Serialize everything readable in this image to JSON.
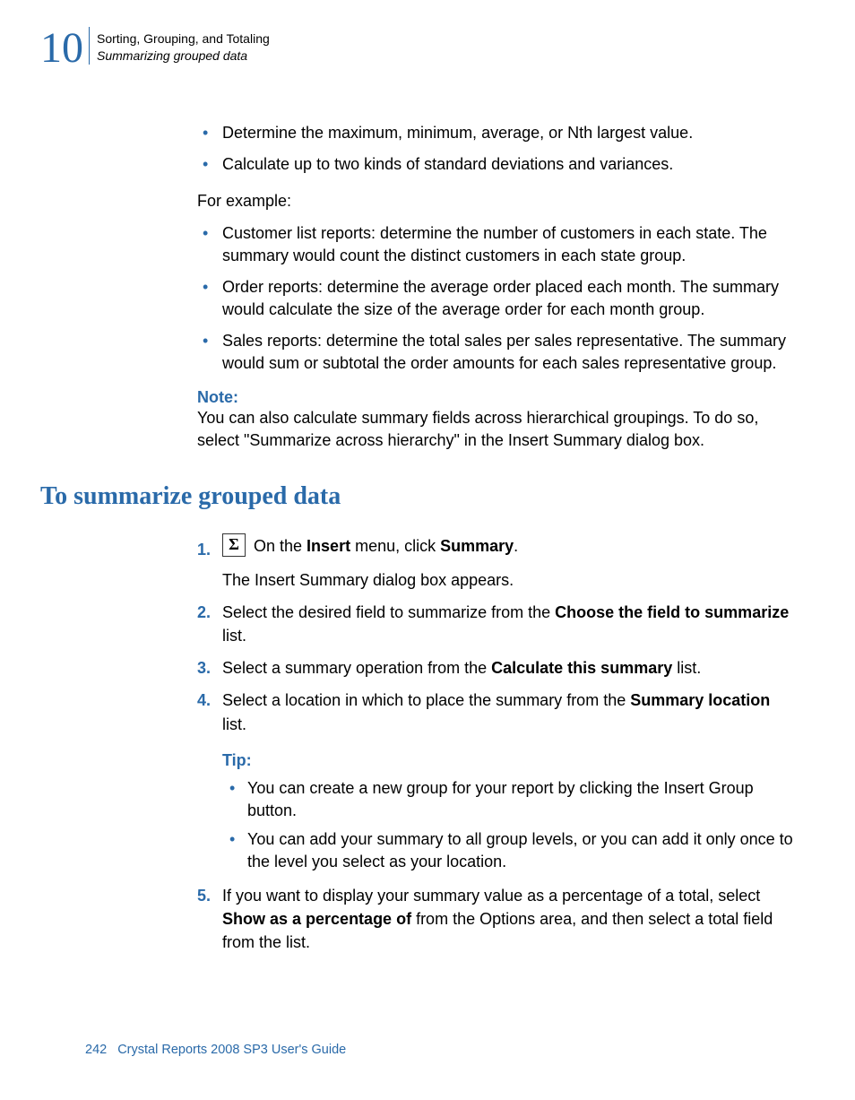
{
  "header": {
    "chapter_number": "10",
    "title": "Sorting, Grouping, and Totaling",
    "subtitle": "Summarizing grouped data"
  },
  "intro_bullets": [
    "Determine the maximum, minimum, average, or Nth largest value.",
    "Calculate up to two kinds of standard deviations and variances."
  ],
  "for_example_label": "For example:",
  "example_bullets": [
    "Customer list reports: determine the number of customers in each state. The summary would count the distinct customers in each state group.",
    "Order reports: determine the average order placed each month. The summary would calculate the size of the average order for each month group.",
    "Sales reports: determine the total sales per sales representative. The summary would sum or subtotal the order amounts for each sales representative group."
  ],
  "note": {
    "label": "Note:",
    "body": "You can also calculate summary fields across hierarchical groupings. To do so, select \"Summarize across hierarchy\" in the Insert Summary dialog box."
  },
  "section_heading": "To summarize grouped data",
  "steps": {
    "s1": {
      "icon_alt": "Σ",
      "pre": " On the ",
      "b1": "Insert",
      "mid": " menu, click ",
      "b2": "Summary",
      "post": ".",
      "sub": "The Insert Summary dialog box appears."
    },
    "s2": {
      "pre": "Select the desired field to summarize from the ",
      "b1": "Choose the field to summarize",
      "post": " list."
    },
    "s3": {
      "pre": "Select a summary operation from the ",
      "b1": "Calculate this summary",
      "post": " list."
    },
    "s4": {
      "pre": "Select a location in which to place the summary from the ",
      "b1": "Summary location",
      "post": " list.",
      "tip_label": "Tip:",
      "tips": [
        "You can create a new group for your report by clicking the Insert Group button.",
        "You can add your summary to all group levels, or you can add it only once to the level you select as your location."
      ]
    },
    "s5": {
      "pre": "If you want to display your summary value as a percentage of a total, select ",
      "b1": "Show as a percentage of",
      "post": " from the Options area, and then select a total field from the list."
    }
  },
  "footer": {
    "page": "242",
    "title": "Crystal Reports 2008 SP3 User's Guide"
  }
}
